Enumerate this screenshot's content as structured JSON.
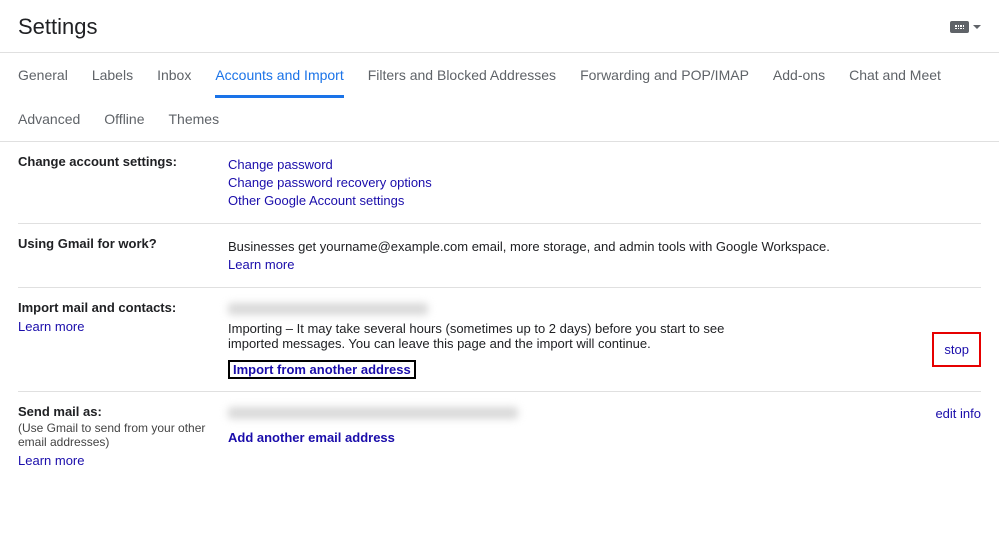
{
  "header": {
    "title": "Settings"
  },
  "tabs": [
    {
      "label": "General"
    },
    {
      "label": "Labels"
    },
    {
      "label": "Inbox"
    },
    {
      "label": "Accounts and Import"
    },
    {
      "label": "Filters and Blocked Addresses"
    },
    {
      "label": "Forwarding and POP/IMAP"
    },
    {
      "label": "Add-ons"
    },
    {
      "label": "Chat and Meet"
    },
    {
      "label": "Advanced"
    },
    {
      "label": "Offline"
    },
    {
      "label": "Themes"
    }
  ],
  "sections": {
    "change_account": {
      "label": "Change account settings:",
      "links": {
        "change_password": "Change password",
        "recovery": "Change password recovery options",
        "other": "Other Google Account settings"
      }
    },
    "gmail_work": {
      "label": "Using Gmail for work?",
      "desc": "Businesses get yourname@example.com email, more storage, and admin tools with Google Workspace.",
      "learn_more": "Learn more"
    },
    "import": {
      "label": "Import mail and contacts:",
      "learn_more": "Learn more",
      "status": "Importing – It may take several hours (sometimes up to 2 days) before you start to see imported messages. You can leave this page and the import will continue.",
      "import_another": "Import from another address",
      "stop": "stop"
    },
    "send_as": {
      "label": "Send mail as:",
      "sublabel": "(Use Gmail to send from your other email addresses)",
      "learn_more": "Learn more",
      "add_another": "Add another email address",
      "edit_info": "edit info"
    }
  }
}
